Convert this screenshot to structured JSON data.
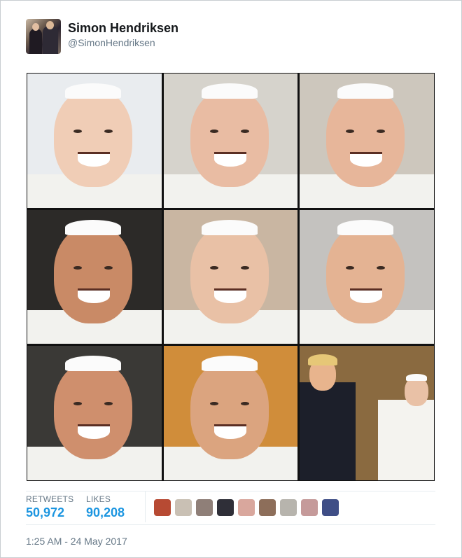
{
  "tweet": {
    "author_name": "Simon Hendriksen",
    "author_handle": "@SimonHendriksen",
    "timestamp": "1:25 AM - 24 May 2017"
  },
  "stats": {
    "retweets_label": "RETWEETS",
    "retweets_value": "50,972",
    "likes_label": "LIKES",
    "likes_value": "90,208"
  },
  "photos": [
    {
      "icon": "laughing-pope-photo",
      "bg": "#e9ecef"
    },
    {
      "icon": "waving-pope-photo",
      "bg": "#d6d3cc"
    },
    {
      "icon": "surprised-pope-photo",
      "bg": "#cdc7bd"
    },
    {
      "icon": "laughing-pope-closeup-photo",
      "bg": "#2c2a28"
    },
    {
      "icon": "smiling-pope-photo",
      "bg": "#c9b6a2"
    },
    {
      "icon": "grinning-pope-photo",
      "bg": "#c4c2bf"
    },
    {
      "icon": "wide-eyed-pope-photo",
      "bg": "#3a3936"
    },
    {
      "icon": "squinting-pope-photo",
      "bg": "#d08d3a"
    },
    {
      "icon": "pope-with-trump-photo",
      "bg": "#8a6a40"
    }
  ],
  "likers": [
    "#b74a33",
    "#c9c0b4",
    "#8f7f78",
    "#2f2f38",
    "#d9a79d",
    "#8d6e5a",
    "#b7b4ad",
    "#c59a9a",
    "#3f4e86"
  ]
}
